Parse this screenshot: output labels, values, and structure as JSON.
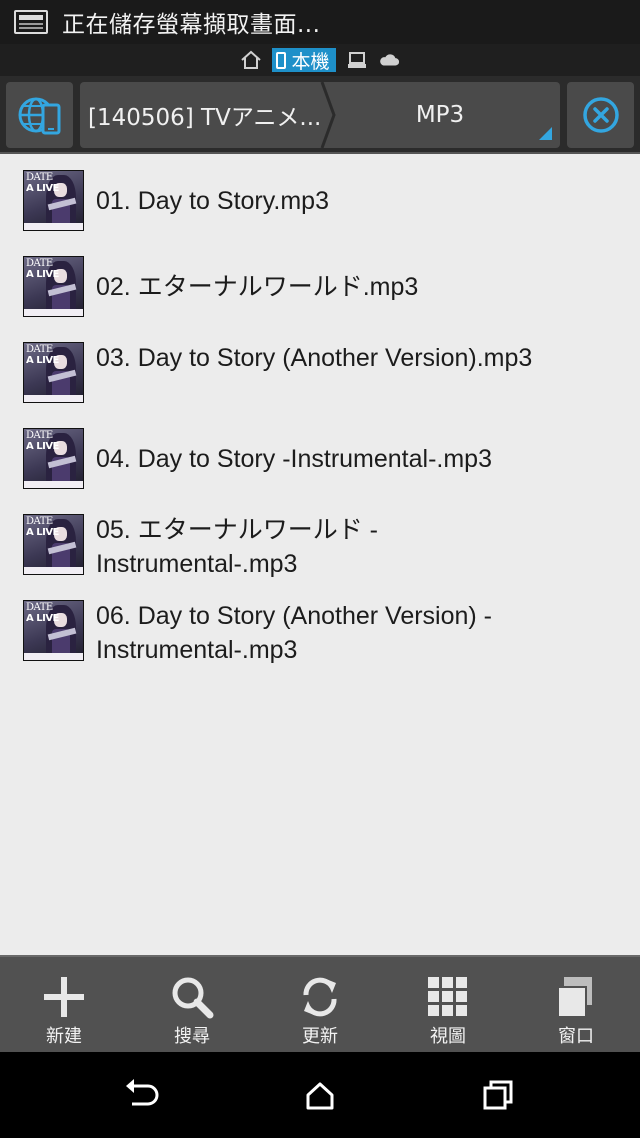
{
  "status_bar": {
    "notification_text": "正在儲存螢幕擷取畫面..."
  },
  "location_bar": {
    "home_icon": "home-icon",
    "device_label": "本機",
    "computer_icon": "computer-icon",
    "cloud_icon": "cloud-icon",
    "accent_color": "#1e90c9"
  },
  "toolbar": {
    "left_icon": "globe-phone-icon",
    "breadcrumb": [
      {
        "label": "[140506] TVアニメ..."
      },
      {
        "label": "MP3"
      }
    ],
    "close_icon": "close-circle-icon",
    "accent_color": "#33a6e0"
  },
  "files": [
    {
      "name": "01. Day to Story.mp3",
      "thumbnail": "album-art",
      "art_text": [
        "DATE",
        "A LIVE"
      ]
    },
    {
      "name": "02. エターナルワールド.mp3",
      "thumbnail": "album-art",
      "art_text": [
        "DATE",
        "A LIVE"
      ]
    },
    {
      "name": "03. Day to Story (Another Version).mp3",
      "thumbnail": "album-art",
      "art_text": [
        "DATE",
        "A LIVE"
      ]
    },
    {
      "name": "04. Day to Story -Instrumental-.mp3",
      "thumbnail": "album-art",
      "art_text": [
        "DATE",
        "A LIVE"
      ]
    },
    {
      "name": "05. エターナルワールド -Instrumental-.mp3",
      "thumbnail": "album-art",
      "art_text": [
        "DATE",
        "A LIVE"
      ]
    },
    {
      "name": "06. Day to Story (Another Version) -Instrumental-.mp3",
      "thumbnail": "album-art",
      "art_text": [
        "DATE",
        "A LIVE"
      ]
    }
  ],
  "actions": [
    {
      "label": "新建",
      "icon": "plus-icon"
    },
    {
      "label": "搜尋",
      "icon": "search-icon"
    },
    {
      "label": "更新",
      "icon": "refresh-icon"
    },
    {
      "label": "視圖",
      "icon": "grid-icon"
    },
    {
      "label": "窗口",
      "icon": "windows-icon"
    }
  ],
  "navigation": {
    "back_icon": "back-icon",
    "home_icon": "nav-home-icon",
    "recents_icon": "recents-icon"
  }
}
